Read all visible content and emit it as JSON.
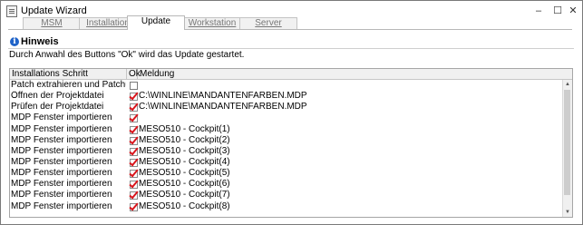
{
  "window": {
    "title": "Update Wizard",
    "minimize_glyph": "–",
    "maximize_glyph": "☐",
    "close_glyph": "✕"
  },
  "tabs": [
    {
      "label": "MSM",
      "active": false
    },
    {
      "label": "Installation",
      "active": false
    },
    {
      "label": "Update",
      "active": true
    },
    {
      "label": "Workstation",
      "active": false
    },
    {
      "label": "Server",
      "active": false
    }
  ],
  "hint": {
    "icon_glyph": "i",
    "title": "Hinweis",
    "text": "Durch Anwahl des Buttons \"Ok\" wird das Update gestartet."
  },
  "grid": {
    "columns": [
      "Installations Schritt",
      "Ok",
      "Meldung"
    ],
    "rows": [
      {
        "step": "Patch extrahieren und Patchupdate ausf…",
        "ok": false,
        "message": ""
      },
      {
        "step": "Öffnen der Projektdatei",
        "ok": true,
        "message": "C:\\WINLINE\\MANDANTENFARBEN.MDP"
      },
      {
        "step": "Prüfen der Projektdatei",
        "ok": true,
        "message": "C:\\WINLINE\\MANDANTENFARBEN.MDP"
      },
      {
        "step": "MDP Fenster importieren",
        "ok": true,
        "message": ""
      },
      {
        "step": "MDP Fenster importieren",
        "ok": true,
        "message": "MESO510 - Cockpit(1)"
      },
      {
        "step": "MDP Fenster importieren",
        "ok": true,
        "message": "MESO510 - Cockpit(2)"
      },
      {
        "step": "MDP Fenster importieren",
        "ok": true,
        "message": "MESO510 - Cockpit(3)"
      },
      {
        "step": "MDP Fenster importieren",
        "ok": true,
        "message": "MESO510 - Cockpit(4)"
      },
      {
        "step": "MDP Fenster importieren",
        "ok": true,
        "message": "MESO510 - Cockpit(5)"
      },
      {
        "step": "MDP Fenster importieren",
        "ok": true,
        "message": "MESO510 - Cockpit(6)"
      },
      {
        "step": "MDP Fenster importieren",
        "ok": true,
        "message": "MESO510 - Cockpit(7)"
      },
      {
        "step": "MDP Fenster importieren",
        "ok": true,
        "message": "MESO510 - Cockpit(8)"
      }
    ]
  },
  "scrollbar": {
    "up_glyph": "▲",
    "down_glyph": "▼"
  },
  "colors": {
    "check": "#d9141b",
    "info_icon": "#1f63c9"
  }
}
